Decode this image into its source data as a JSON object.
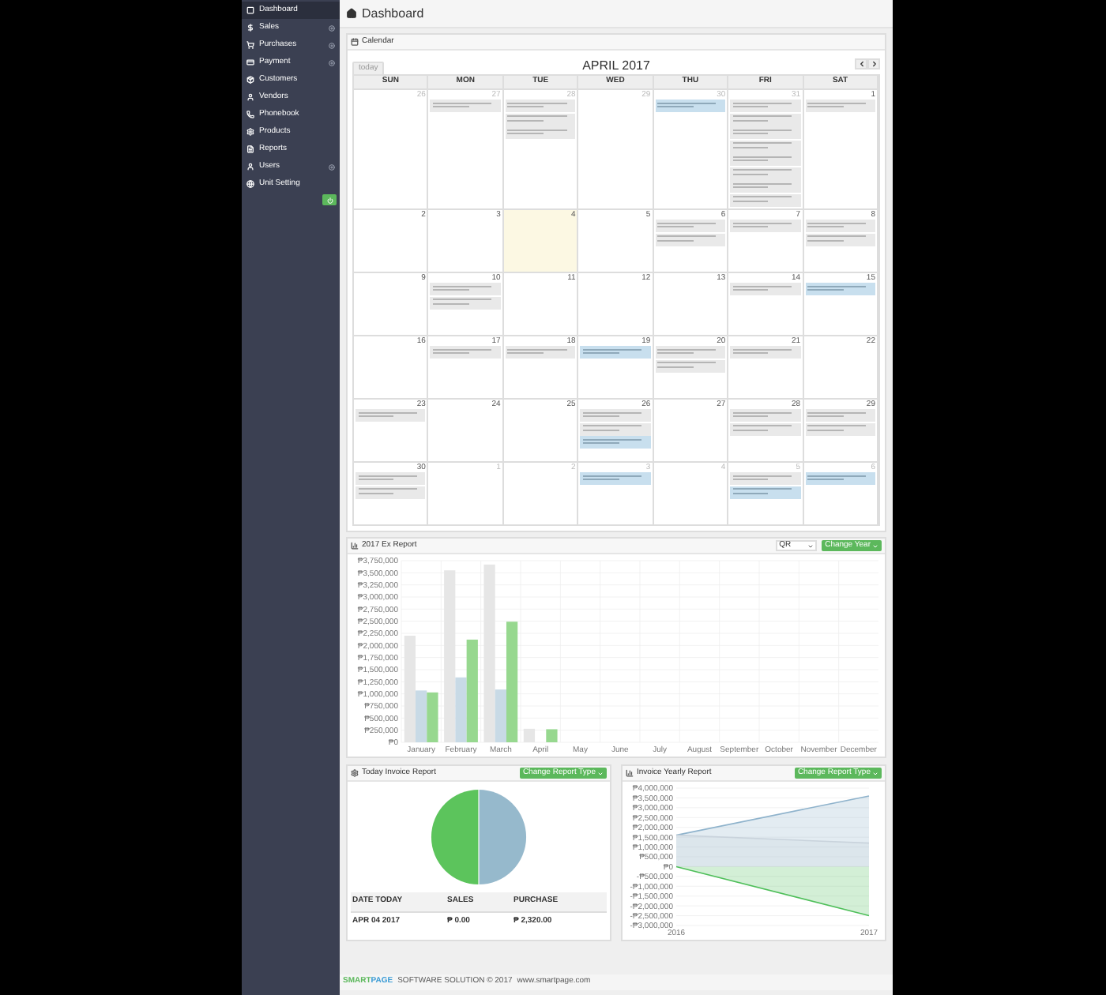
{
  "sidebar": {
    "items": [
      {
        "label": "Dashboard",
        "selected": true,
        "expandable": false
      },
      {
        "label": "Sales",
        "selected": false,
        "expandable": true
      },
      {
        "label": "Purchases",
        "selected": false,
        "expandable": true
      },
      {
        "label": "Payment",
        "selected": false,
        "expandable": true
      },
      {
        "label": "Customers",
        "selected": false,
        "expandable": false
      },
      {
        "label": "Vendors",
        "selected": false,
        "expandable": false
      },
      {
        "label": "Phonebook",
        "selected": false,
        "expandable": false
      },
      {
        "label": "Products",
        "selected": false,
        "expandable": false
      },
      {
        "label": "Reports",
        "selected": false,
        "expandable": false
      },
      {
        "label": "Users",
        "selected": false,
        "expandable": true
      },
      {
        "label": "Unit Setting",
        "selected": false,
        "expandable": false
      }
    ]
  },
  "page_title": "Dashboard",
  "calendar": {
    "title": "Calendar",
    "today_button": "today",
    "month": "APRIL 2017",
    "weekdays": [
      "SUN",
      "MON",
      "TUE",
      "WED",
      "THU",
      "FRI",
      "SAT"
    ],
    "weeks": [
      {
        "days": [
          {
            "date": "26",
            "other_month": true,
            "today": false
          },
          {
            "date": "27",
            "other_month": true,
            "today": false,
            "events": [
              {
                "kind": "check"
              }
            ]
          },
          {
            "date": "28",
            "other_month": true,
            "today": false,
            "events": [
              {
                "kind": "check"
              },
              {
                "kind": "check"
              },
              {
                "kind": "check"
              }
            ]
          },
          {
            "date": "29",
            "other_month": true,
            "today": false
          },
          {
            "date": "30",
            "other_month": true,
            "today": false,
            "events": [
              {
                "kind": "pay"
              }
            ]
          },
          {
            "date": "31",
            "other_month": true,
            "today": false,
            "events": [
              {
                "kind": "check"
              },
              {
                "kind": "check"
              },
              {
                "kind": "check"
              },
              {
                "kind": "check"
              },
              {
                "kind": "check"
              },
              {
                "kind": "check"
              },
              {
                "kind": "check"
              },
              {
                "kind": "check"
              }
            ]
          },
          {
            "date": "1",
            "other_month": false,
            "today": false,
            "events": [
              {
                "kind": "check"
              }
            ]
          }
        ]
      },
      {
        "days": [
          {
            "date": "2",
            "other_month": false,
            "today": false
          },
          {
            "date": "3",
            "other_month": false,
            "today": false
          },
          {
            "date": "4",
            "other_month": false,
            "today": true
          },
          {
            "date": "5",
            "other_month": false,
            "today": false
          },
          {
            "date": "6",
            "other_month": false,
            "today": false,
            "events": [
              {
                "kind": "check"
              },
              {
                "kind": "check"
              }
            ]
          },
          {
            "date": "7",
            "other_month": false,
            "today": false,
            "events": [
              {
                "kind": "check"
              }
            ]
          },
          {
            "date": "8",
            "other_month": false,
            "today": false,
            "events": [
              {
                "kind": "check"
              },
              {
                "kind": "check"
              }
            ]
          }
        ]
      },
      {
        "days": [
          {
            "date": "9",
            "other_month": false,
            "today": false
          },
          {
            "date": "10",
            "other_month": false,
            "today": false,
            "events": [
              {
                "kind": "check"
              },
              {
                "kind": "check"
              }
            ]
          },
          {
            "date": "11",
            "other_month": false,
            "today": false
          },
          {
            "date": "12",
            "other_month": false,
            "today": false
          },
          {
            "date": "13",
            "other_month": false,
            "today": false
          },
          {
            "date": "14",
            "other_month": false,
            "today": false,
            "events": [
              {
                "kind": "check"
              }
            ]
          },
          {
            "date": "15",
            "other_month": false,
            "today": false,
            "events": [
              {
                "kind": "pay"
              }
            ]
          }
        ]
      },
      {
        "days": [
          {
            "date": "16",
            "other_month": false,
            "today": false
          },
          {
            "date": "17",
            "other_month": false,
            "today": false,
            "events": [
              {
                "kind": "check"
              }
            ]
          },
          {
            "date": "18",
            "other_month": false,
            "today": false,
            "events": [
              {
                "kind": "check"
              }
            ]
          },
          {
            "date": "19",
            "other_month": false,
            "today": false,
            "events": [
              {
                "kind": "pay"
              }
            ]
          },
          {
            "date": "20",
            "other_month": false,
            "today": false,
            "events": [
              {
                "kind": "check"
              },
              {
                "kind": "check"
              }
            ]
          },
          {
            "date": "21",
            "other_month": false,
            "today": false,
            "events": [
              {
                "kind": "check"
              }
            ]
          },
          {
            "date": "22",
            "other_month": false,
            "today": false
          }
        ]
      },
      {
        "days": [
          {
            "date": "23",
            "other_month": false,
            "today": false,
            "events": [
              {
                "kind": "check"
              }
            ]
          },
          {
            "date": "24",
            "other_month": false,
            "today": false
          },
          {
            "date": "25",
            "other_month": false,
            "today": false
          },
          {
            "date": "26",
            "other_month": false,
            "today": false,
            "events": [
              {
                "kind": "check"
              },
              {
                "kind": "check"
              },
              {
                "kind": "pay"
              }
            ]
          },
          {
            "date": "27",
            "other_month": false,
            "today": false
          },
          {
            "date": "28",
            "other_month": false,
            "today": false,
            "events": [
              {
                "kind": "check"
              },
              {
                "kind": "check"
              }
            ]
          },
          {
            "date": "29",
            "other_month": false,
            "today": false,
            "events": [
              {
                "kind": "check"
              },
              {
                "kind": "check"
              }
            ]
          }
        ]
      },
      {
        "days": [
          {
            "date": "30",
            "other_month": false,
            "today": false,
            "events": [
              {
                "kind": "check"
              },
              {
                "kind": "check"
              }
            ]
          },
          {
            "date": "1",
            "other_month": true,
            "today": false
          },
          {
            "date": "2",
            "other_month": true,
            "today": false
          },
          {
            "date": "3",
            "other_month": true,
            "today": false,
            "events": [
              {
                "kind": "pay"
              }
            ]
          },
          {
            "date": "4",
            "other_month": true,
            "today": false
          },
          {
            "date": "5",
            "other_month": true,
            "today": false,
            "events": [
              {
                "kind": "check"
              },
              {
                "kind": "pay"
              }
            ]
          },
          {
            "date": "6",
            "other_month": true,
            "today": false,
            "events": [
              {
                "kind": "pay"
              }
            ]
          }
        ]
      }
    ]
  },
  "expense_report": {
    "title": "2017 Ex Report",
    "year_select": "QR",
    "button": "Change Year",
    "chart_data": {
      "type": "bar",
      "categories": [
        "January",
        "February",
        "March",
        "April",
        "May",
        "June",
        "July",
        "August",
        "September",
        "October",
        "November",
        "December"
      ],
      "series": [
        {
          "color": "#e6e6e6",
          "values": [
            2200000,
            3550000,
            3670000,
            280000,
            null,
            null,
            null,
            null,
            null,
            null,
            null,
            null
          ]
        },
        {
          "color": "#c8dae6",
          "values": [
            1070000,
            1340000,
            1090000,
            null,
            null,
            null,
            null,
            null,
            null,
            null,
            null,
            null
          ]
        },
        {
          "color": "#97d88f",
          "values": [
            1030000,
            2120000,
            2490000,
            270000,
            null,
            null,
            null,
            null,
            null,
            null,
            null,
            null
          ]
        }
      ],
      "ylim": [
        0,
        3750000
      ],
      "grid": true,
      "yticks": [
        {
          "value": 0,
          "label": "₱0"
        },
        {
          "value": 250000,
          "label": "₱250,000"
        },
        {
          "value": 500000,
          "label": "₱500,000"
        },
        {
          "value": 750000,
          "label": "₱750,000"
        },
        {
          "value": 1000000,
          "label": "₱1,000,000"
        },
        {
          "value": 1250000,
          "label": "₱1,250,000"
        },
        {
          "value": 1500000,
          "label": "₱1,500,000"
        },
        {
          "value": 1750000,
          "label": "₱1,750,000"
        },
        {
          "value": 2000000,
          "label": "₱2,000,000"
        },
        {
          "value": 2250000,
          "label": "₱2,250,000"
        },
        {
          "value": 2500000,
          "label": "₱2,500,000"
        },
        {
          "value": 2750000,
          "label": "₱2,750,000"
        },
        {
          "value": 3000000,
          "label": "₱3,000,000"
        },
        {
          "value": 3250000,
          "label": "₱3,250,000"
        },
        {
          "value": 3500000,
          "label": "₱3,500,000"
        },
        {
          "value": 3750000,
          "label": "₱3,750,000"
        }
      ]
    }
  },
  "today_report": {
    "title": "Today Invoice Report",
    "button": "Change Report Type",
    "table": {
      "columns": [
        "DATE TODAY",
        "SALES",
        "PURCHASE"
      ],
      "rows": [
        [
          "APR 04 2017",
          "₱ 0.00",
          "₱ 2,320.00"
        ]
      ]
    }
  },
  "yearly_report": {
    "title": "Invoice Yearly Report",
    "button": "Change Report Type",
    "chart_data": {
      "type": "area",
      "x": [
        2016,
        2017
      ],
      "series": [
        {
          "color": "#8fb3cc",
          "values": [
            1600000,
            3600000
          ]
        },
        {
          "color": "#c9d3dc",
          "values": [
            1600000,
            1200000
          ]
        },
        {
          "color": "#4fbf5a",
          "values": [
            0,
            -2500000
          ]
        }
      ],
      "xlim": [
        2016,
        2017
      ],
      "grid": true,
      "ylim": [
        -3000000,
        4000000
      ],
      "xticks": [
        2016,
        2017
      ],
      "yticks": [
        {
          "value": -3000000,
          "label": "-₱3,000,000"
        },
        {
          "value": -2500000,
          "label": "-₱2,500,000"
        },
        {
          "value": -2000000,
          "label": "-₱2,000,000"
        },
        {
          "value": -1500000,
          "label": "-₱1,500,000"
        },
        {
          "value": -1000000,
          "label": "-₱1,000,000"
        },
        {
          "value": -500000,
          "label": "-₱500,000"
        },
        {
          "value": 0,
          "label": "₱0"
        },
        {
          "value": 500000,
          "label": "₱500,000"
        },
        {
          "value": 1000000,
          "label": "₱1,000,000"
        },
        {
          "value": 1500000,
          "label": "₱1,500,000"
        },
        {
          "value": 2000000,
          "label": "₱2,000,000"
        },
        {
          "value": 2500000,
          "label": "₱2,500,000"
        },
        {
          "value": 3000000,
          "label": "₱3,000,000"
        },
        {
          "value": 3500000,
          "label": "₱3,500,000"
        },
        {
          "value": 4000000,
          "label": "₱4,000,000"
        }
      ]
    }
  },
  "footer": {
    "logo": [
      "SMART",
      "PAGE"
    ],
    "text": "SOFTWARE SOLUTION © 2017",
    "link": "www.smartpage.com"
  }
}
